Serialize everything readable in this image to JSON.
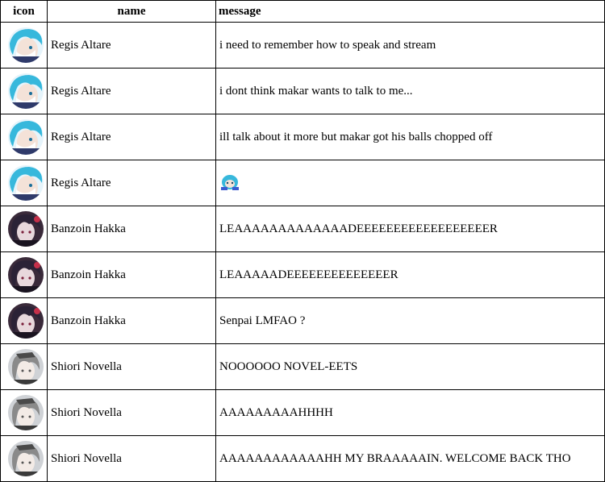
{
  "table": {
    "headers": {
      "icon": "icon",
      "name": "name",
      "message": "message"
    },
    "rows": [
      {
        "avatar": "regis-avatar",
        "name": "Regis Altare",
        "message": "i need to remember how to speak and stream"
      },
      {
        "avatar": "regis-avatar",
        "name": "Regis Altare",
        "message": "i dont think makar wants to talk to me..."
      },
      {
        "avatar": "regis-avatar",
        "name": "Regis Altare",
        "message": "ill talk about it more but makar got his balls chopped off"
      },
      {
        "avatar": "regis-avatar",
        "name": "Regis Altare",
        "message": "",
        "emote": "blue-character-emote"
      },
      {
        "avatar": "banzoin-avatar",
        "name": "Banzoin Hakka",
        "message": "LEAAAAAAAAAAAAADEEEEEEEEEEEEEEEEEER"
      },
      {
        "avatar": "banzoin-avatar",
        "name": "Banzoin Hakka",
        "message": "LEAAAAADEEEEEEEEEEEEEER"
      },
      {
        "avatar": "banzoin-avatar",
        "name": "Banzoin Hakka",
        "message": "Senpai LMFAO ?"
      },
      {
        "avatar": "shiori-avatar",
        "name": "Shiori Novella",
        "message": "NOOOOOO NOVEL-EETS"
      },
      {
        "avatar": "shiori-avatar",
        "name": "Shiori Novella",
        "message": "AAAAAAAAAHHHH"
      },
      {
        "avatar": "shiori-avatar",
        "name": "Shiori Novella",
        "message": "AAAAAAAAAAAAHH MY BRAAAAAIN. WELCOME BACK THO"
      }
    ]
  },
  "colors": {
    "border": "#000000",
    "regis_hair": "#37b8dc",
    "banzoin_hair": "#2b2236",
    "banzoin_accent": "#c4304a",
    "shiori_hair": "#8a8a8a",
    "skin": "#f4e2d8"
  }
}
